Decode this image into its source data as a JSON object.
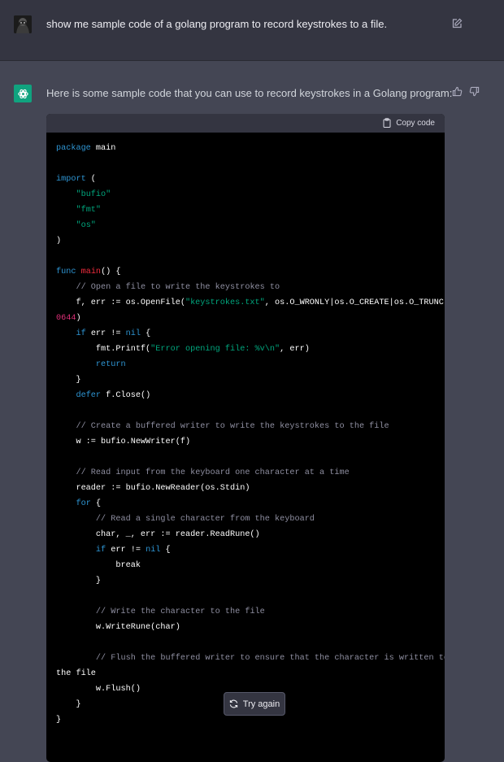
{
  "user": {
    "message": "show me sample code of a golang program to record keystrokes to a file."
  },
  "assistant": {
    "intro": "Here is some sample code that you can use to record keystrokes in a Golang program:",
    "copy_label": "Copy code",
    "code_language": "go",
    "code_lines": [
      "package main",
      "",
      "import (",
      "    \"bufio\"",
      "    \"fmt\"",
      "    \"os\"",
      ")",
      "",
      "func main() {",
      "    // Open a file to write the keystrokes to",
      "    f, err := os.OpenFile(\"keystrokes.txt\", os.O_WRONLY|os.O_CREATE|os.O_TRUNC,",
      "0644)",
      "    if err != nil {",
      "        fmt.Printf(\"Error opening file: %v\\n\", err)",
      "        return",
      "    }",
      "    defer f.Close()",
      "",
      "    // Create a buffered writer to write the keystrokes to the file",
      "    w := bufio.NewWriter(f)",
      "",
      "    // Read input from the keyboard one character at a time",
      "    reader := bufio.NewReader(os.Stdin)",
      "    for {",
      "        // Read a single character from the keyboard",
      "        char, _, err := reader.ReadRune()",
      "        if err != nil {",
      "            break",
      "        }",
      "",
      "        // Write the character to the file",
      "        w.WriteRune(char)",
      "",
      "        // Flush the buffered writer to ensure that the character is written to",
      "the file",
      "        w.Flush()",
      "    }",
      "}"
    ]
  },
  "actions": {
    "try_again_label": "Try again"
  },
  "icons": {
    "edit": "edit-icon",
    "thumbs_up": "thumbs-up-icon",
    "thumbs_down": "thumbs-down-icon",
    "clipboard": "clipboard-icon",
    "refresh": "refresh-icon",
    "openai_logo": "openai-logo-icon"
  },
  "colors": {
    "user_bg": "#343541",
    "assistant_bg": "#444654",
    "code_bg": "#000000",
    "keyword": "#2e95d3",
    "string": "#00a67d",
    "comment": "#8e8ea0",
    "function": "#f22c3d",
    "number": "#df3079",
    "brand": "#10a37f"
  }
}
